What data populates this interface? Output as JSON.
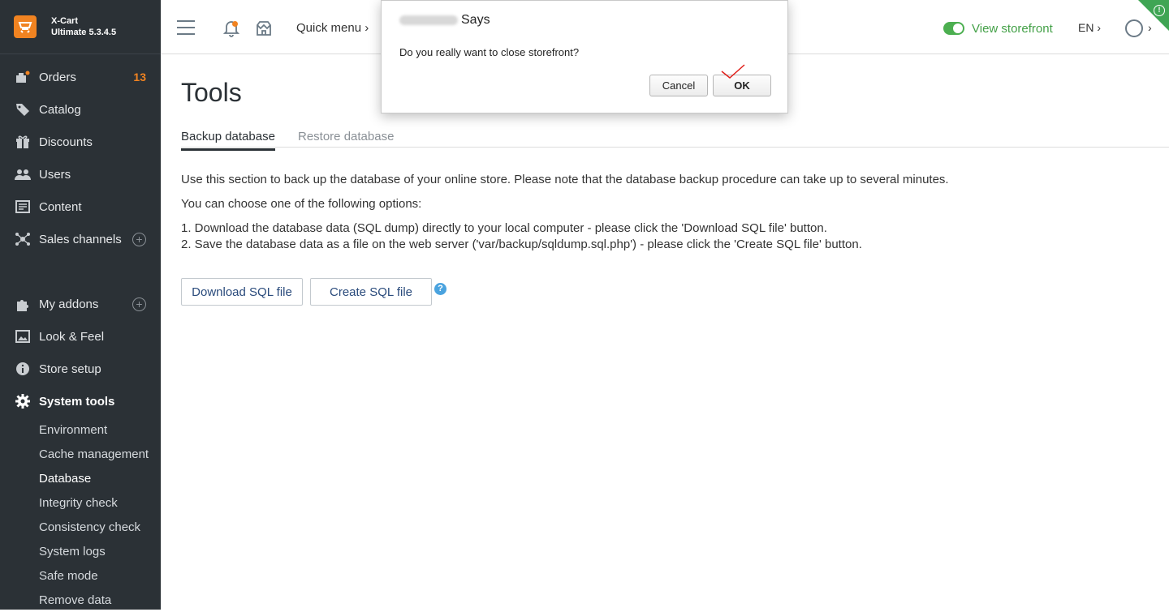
{
  "brand": {
    "name": "X-Cart",
    "version": "Ultimate 5.3.4.5",
    "accent": "#f18321"
  },
  "sidebar": {
    "items": [
      {
        "label": "Orders",
        "icon": "orders-icon",
        "count": "13"
      },
      {
        "label": "Catalog",
        "icon": "tag-icon"
      },
      {
        "label": "Discounts",
        "icon": "gift-icon"
      },
      {
        "label": "Users",
        "icon": "users-icon"
      },
      {
        "label": "Content",
        "icon": "content-icon"
      },
      {
        "label": "Sales channels",
        "icon": "network-icon"
      },
      {
        "label": "My addons",
        "icon": "puzzle-icon"
      },
      {
        "label": "Look & Feel",
        "icon": "image-icon"
      },
      {
        "label": "Store setup",
        "icon": "info-icon"
      },
      {
        "label": "System tools",
        "icon": "gear-icon"
      }
    ],
    "subitems": [
      {
        "label": "Environment"
      },
      {
        "label": "Cache management"
      },
      {
        "label": "Database"
      },
      {
        "label": "Integrity check"
      },
      {
        "label": "Consistency check"
      },
      {
        "label": "System logs"
      },
      {
        "label": "Safe mode"
      },
      {
        "label": "Remove data"
      }
    ]
  },
  "header": {
    "quick_menu": "Quick menu ›",
    "view_storefront": "View storefront",
    "lang": "EN ›",
    "user_chevron": "›",
    "notice": "!"
  },
  "page": {
    "title": "Tools",
    "tabs": [
      {
        "label": "Backup database"
      },
      {
        "label": "Restore database"
      }
    ],
    "intro": "Use this section to back up the database of your online store. Please note that the database backup procedure can take up to several minutes.",
    "choose": "You can choose one of the following options:",
    "option1": "1. Download the database data (SQL dump) directly to your local computer - please click the 'Download SQL file' button.",
    "option2": "2. Save the database data as a file on the web server ('var/backup/sqldump.sql.php') - please click the 'Create SQL file' button.",
    "download_btn": "Download SQL file",
    "create_btn": "Create SQL file",
    "help": "?"
  },
  "dialog": {
    "title_suffix": "Says",
    "message": "Do you really want to close storefront?",
    "cancel": "Cancel",
    "ok": "OK"
  }
}
